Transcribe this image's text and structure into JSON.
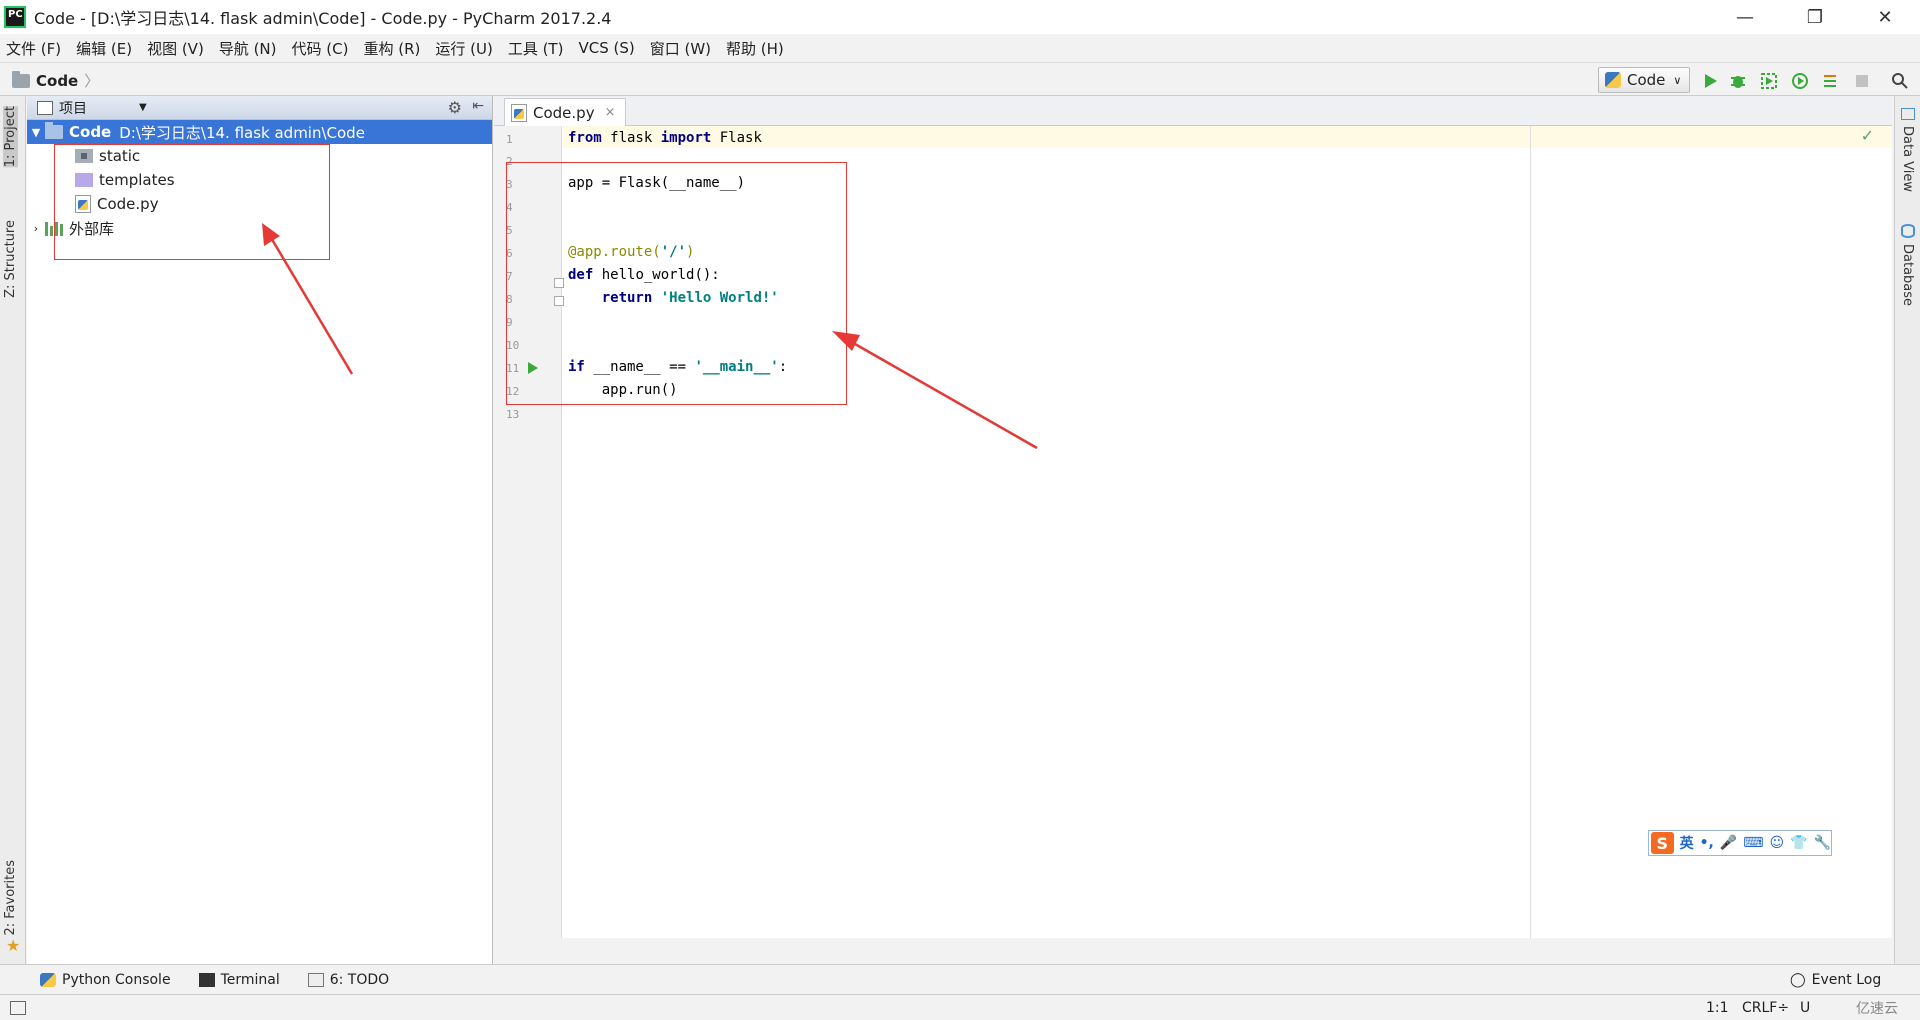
{
  "window": {
    "title": "Code - [D:\\学习日志\\14. flask admin\\Code] - Code.py - PyCharm 2017.2.4",
    "app_icon_text": "PC",
    "minimize": "—",
    "restore": "❐",
    "close": "✕"
  },
  "menu": [
    "文件 (F)",
    "编辑 (E)",
    "视图 (V)",
    "导航 (N)",
    "代码 (C)",
    "重构 (R)",
    "运行 (U)",
    "工具 (T)",
    "VCS (S)",
    "窗口 (W)",
    "帮助 (H)"
  ],
  "navbar": {
    "breadcrumb": "Code",
    "run_config": "Code"
  },
  "left_tabs": {
    "project": "1: Project",
    "structure": "Z: Structure",
    "favorites": "2: Favorites"
  },
  "project_panel": {
    "header": "项目",
    "root": {
      "name": "Code",
      "path": "D:\\学习日志\\14. flask admin\\Code"
    },
    "children": [
      "static",
      "templates",
      "Code.py"
    ],
    "external": "外部库"
  },
  "editor": {
    "tab": "Code.py",
    "line_numbers": [
      "1",
      "2",
      "3",
      "4",
      "5",
      "6",
      "7",
      "8",
      "9",
      "10",
      "11",
      "12",
      "13"
    ]
  },
  "right_tabs": {
    "data_view": "Data View",
    "database": "Database"
  },
  "bottom_tools": {
    "python_console": "Python Console",
    "terminal": "Terminal",
    "todo": "6: TODO",
    "event_log": "Event Log"
  },
  "status": {
    "position": "1:1",
    "line_sep": "CRLF÷",
    "encoding": "U",
    "watermark": "亿速云"
  },
  "ime": {
    "logo": "S",
    "lang": "英"
  },
  "colors": {
    "selection": "#3875d7",
    "annotation": "#e53935",
    "keyword": "#000080",
    "string": "#008080"
  }
}
